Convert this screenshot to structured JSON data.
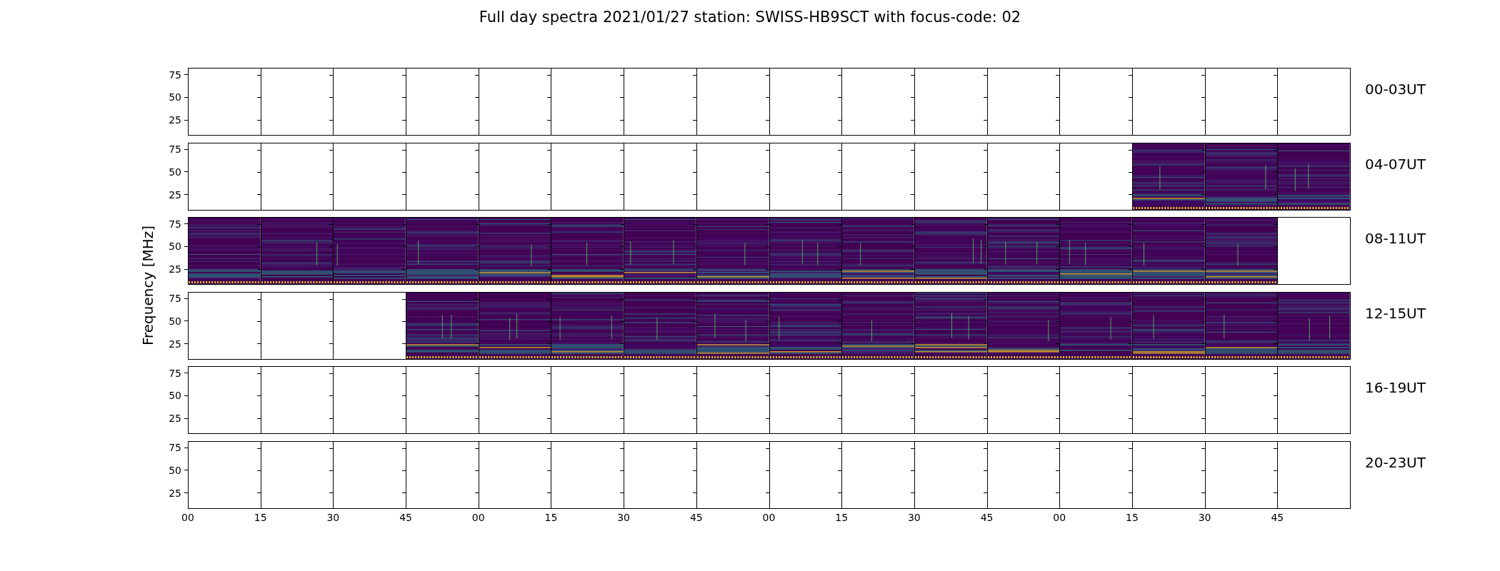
{
  "title": "Full day spectra 2021/01/27 station: SWISS-HB9SCT with focus-code: 02",
  "ylabel": "Frequency [MHz]",
  "rows": [
    {
      "label": "00-03UT",
      "yticks": [
        "75",
        "50",
        "25"
      ],
      "panels": [
        {
          "spectrum": false
        },
        {
          "spectrum": false
        },
        {
          "spectrum": false
        },
        {
          "spectrum": false
        },
        {
          "spectrum": false
        },
        {
          "spectrum": false
        },
        {
          "spectrum": false
        },
        {
          "spectrum": false
        },
        {
          "spectrum": false
        },
        {
          "spectrum": false
        },
        {
          "spectrum": false
        },
        {
          "spectrum": false
        },
        {
          "spectrum": false
        },
        {
          "spectrum": false
        },
        {
          "spectrum": false
        },
        {
          "spectrum": false
        }
      ]
    },
    {
      "label": "04-07UT",
      "yticks": [
        "75",
        "50",
        "25"
      ],
      "panels": [
        {
          "spectrum": false
        },
        {
          "spectrum": false
        },
        {
          "spectrum": false
        },
        {
          "spectrum": false
        },
        {
          "spectrum": false
        },
        {
          "spectrum": false
        },
        {
          "spectrum": false
        },
        {
          "spectrum": false
        },
        {
          "spectrum": false
        },
        {
          "spectrum": false
        },
        {
          "spectrum": false
        },
        {
          "spectrum": false
        },
        {
          "spectrum": false
        },
        {
          "spectrum": true
        },
        {
          "spectrum": true
        },
        {
          "spectrum": true
        }
      ]
    },
    {
      "label": "08-11UT",
      "yticks": [
        "75",
        "50",
        "25"
      ],
      "panels": [
        {
          "spectrum": true
        },
        {
          "spectrum": true
        },
        {
          "spectrum": true
        },
        {
          "spectrum": true
        },
        {
          "spectrum": true
        },
        {
          "spectrum": true
        },
        {
          "spectrum": true
        },
        {
          "spectrum": true
        },
        {
          "spectrum": true
        },
        {
          "spectrum": true
        },
        {
          "spectrum": true
        },
        {
          "spectrum": true
        },
        {
          "spectrum": true
        },
        {
          "spectrum": true
        },
        {
          "spectrum": true
        },
        {
          "spectrum": false
        }
      ]
    },
    {
      "label": "12-15UT",
      "yticks": [
        "75",
        "50",
        "25"
      ],
      "panels": [
        {
          "spectrum": false
        },
        {
          "spectrum": false
        },
        {
          "spectrum": false
        },
        {
          "spectrum": true
        },
        {
          "spectrum": true
        },
        {
          "spectrum": true
        },
        {
          "spectrum": true
        },
        {
          "spectrum": true
        },
        {
          "spectrum": true
        },
        {
          "spectrum": true
        },
        {
          "spectrum": true
        },
        {
          "spectrum": true
        },
        {
          "spectrum": true
        },
        {
          "spectrum": true
        },
        {
          "spectrum": true
        },
        {
          "spectrum": true
        }
      ]
    },
    {
      "label": "16-19UT",
      "yticks": [
        "75",
        "50",
        "25"
      ],
      "panels": [
        {
          "spectrum": false
        },
        {
          "spectrum": false
        },
        {
          "spectrum": false
        },
        {
          "spectrum": false
        },
        {
          "spectrum": false
        },
        {
          "spectrum": false
        },
        {
          "spectrum": false
        },
        {
          "spectrum": false
        },
        {
          "spectrum": false
        },
        {
          "spectrum": false
        },
        {
          "spectrum": false
        },
        {
          "spectrum": false
        },
        {
          "spectrum": false
        },
        {
          "spectrum": false
        },
        {
          "spectrum": false
        },
        {
          "spectrum": false
        }
      ]
    },
    {
      "label": "20-23UT",
      "yticks": [
        "75",
        "50",
        "25"
      ],
      "panels": [
        {
          "spectrum": false
        },
        {
          "spectrum": false
        },
        {
          "spectrum": false
        },
        {
          "spectrum": false
        },
        {
          "spectrum": false
        },
        {
          "spectrum": false
        },
        {
          "spectrum": false
        },
        {
          "spectrum": false
        },
        {
          "spectrum": false
        },
        {
          "spectrum": false
        },
        {
          "spectrum": false
        },
        {
          "spectrum": false
        },
        {
          "spectrum": false
        },
        {
          "spectrum": false
        },
        {
          "spectrum": false
        },
        {
          "spectrum": false
        }
      ]
    }
  ],
  "xticks": [
    "00",
    "15",
    "30",
    "45",
    "00",
    "15",
    "30",
    "45",
    "00",
    "15",
    "30",
    "45",
    "00",
    "15",
    "30",
    "45"
  ]
}
